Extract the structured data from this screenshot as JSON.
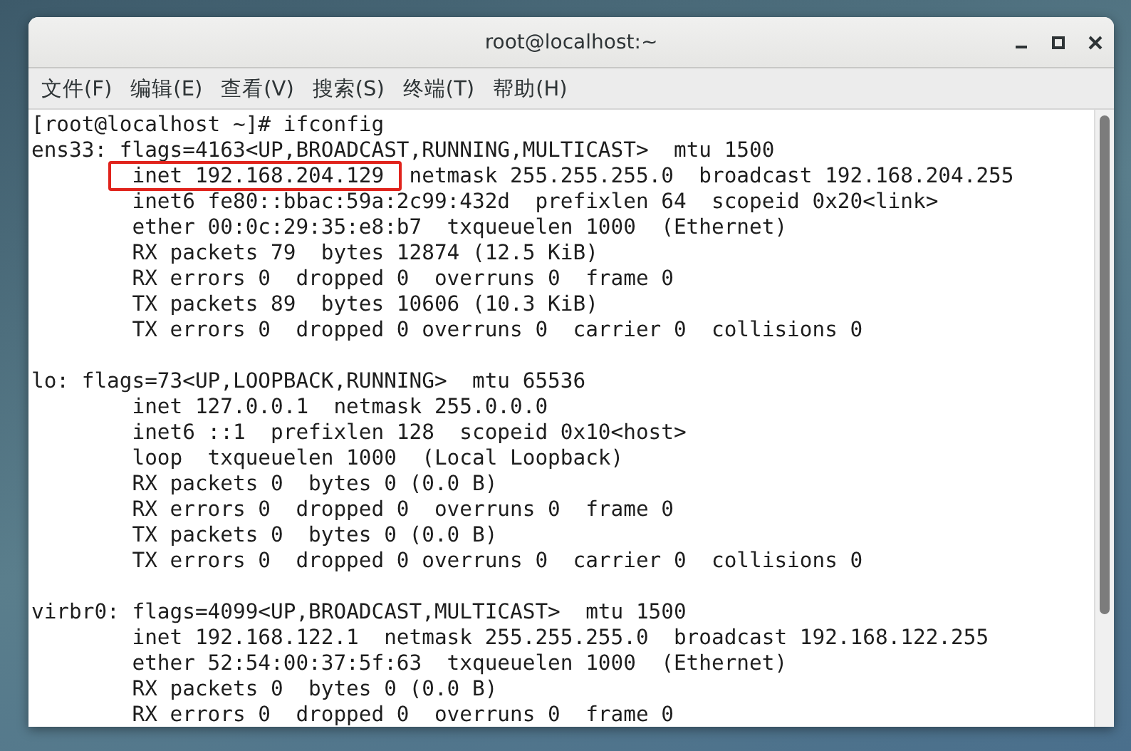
{
  "window": {
    "title": "root@localhost:~"
  },
  "menu": [
    {
      "label": "文件(F)"
    },
    {
      "label": "编辑(E)"
    },
    {
      "label": "查看(V)"
    },
    {
      "label": "搜索(S)"
    },
    {
      "label": "终端(T)"
    },
    {
      "label": "帮助(H)"
    }
  ],
  "terminal": {
    "prompt": "[root@localhost ~]# ifconfig",
    "blocks": [
      {
        "header": "ens33: flags=4163<UP,BROADCAST,RUNNING,MULTICAST>  mtu 1500",
        "lines": [
          {
            "parts": [
              {
                "text": "inet 192.168.204.129",
                "highlighted": true
              },
              {
                "text": "  netmask 255.255.255.0  broadcast 192.168.204.255",
                "highlighted": false
              }
            ]
          },
          {
            "parts": [
              {
                "text": "inet6 fe80::bbac:59a:2c99:432d  prefixlen 64  scopeid 0x20<link>",
                "highlighted": false
              }
            ]
          },
          {
            "parts": [
              {
                "text": "ether 00:0c:29:35:e8:b7  txqueuelen 1000  (Ethernet)",
                "highlighted": false
              }
            ]
          },
          {
            "parts": [
              {
                "text": "RX packets 79  bytes 12874 (12.5 KiB)",
                "highlighted": false
              }
            ]
          },
          {
            "parts": [
              {
                "text": "RX errors 0  dropped 0  overruns 0  frame 0",
                "highlighted": false
              }
            ]
          },
          {
            "parts": [
              {
                "text": "TX packets 89  bytes 10606 (10.3 KiB)",
                "highlighted": false
              }
            ]
          },
          {
            "parts": [
              {
                "text": "TX errors 0  dropped 0 overruns 0  carrier 0  collisions 0",
                "highlighted": false
              }
            ]
          }
        ]
      },
      {
        "header": "lo: flags=73<UP,LOOPBACK,RUNNING>  mtu 65536",
        "lines": [
          {
            "parts": [
              {
                "text": "inet 127.0.0.1  netmask 255.0.0.0",
                "highlighted": false
              }
            ]
          },
          {
            "parts": [
              {
                "text": "inet6 ::1  prefixlen 128  scopeid 0x10<host>",
                "highlighted": false
              }
            ]
          },
          {
            "parts": [
              {
                "text": "loop  txqueuelen 1000  (Local Loopback)",
                "highlighted": false
              }
            ]
          },
          {
            "parts": [
              {
                "text": "RX packets 0  bytes 0 (0.0 B)",
                "highlighted": false
              }
            ]
          },
          {
            "parts": [
              {
                "text": "RX errors 0  dropped 0  overruns 0  frame 0",
                "highlighted": false
              }
            ]
          },
          {
            "parts": [
              {
                "text": "TX packets 0  bytes 0 (0.0 B)",
                "highlighted": false
              }
            ]
          },
          {
            "parts": [
              {
                "text": "TX errors 0  dropped 0 overruns 0  carrier 0  collisions 0",
                "highlighted": false
              }
            ]
          }
        ]
      },
      {
        "header": "virbr0: flags=4099<UP,BROADCAST,MULTICAST>  mtu 1500",
        "lines": [
          {
            "parts": [
              {
                "text": "inet 192.168.122.1  netmask 255.255.255.0  broadcast 192.168.122.255",
                "highlighted": false
              }
            ]
          },
          {
            "parts": [
              {
                "text": "ether 52:54:00:37:5f:63  txqueuelen 1000  (Ethernet)",
                "highlighted": false
              }
            ]
          },
          {
            "parts": [
              {
                "text": "RX packets 0  bytes 0 (0.0 B)",
                "highlighted": false
              }
            ]
          },
          {
            "parts": [
              {
                "text": "RX errors 0  dropped 0  overruns 0  frame 0",
                "highlighted": false
              }
            ]
          }
        ]
      }
    ]
  }
}
